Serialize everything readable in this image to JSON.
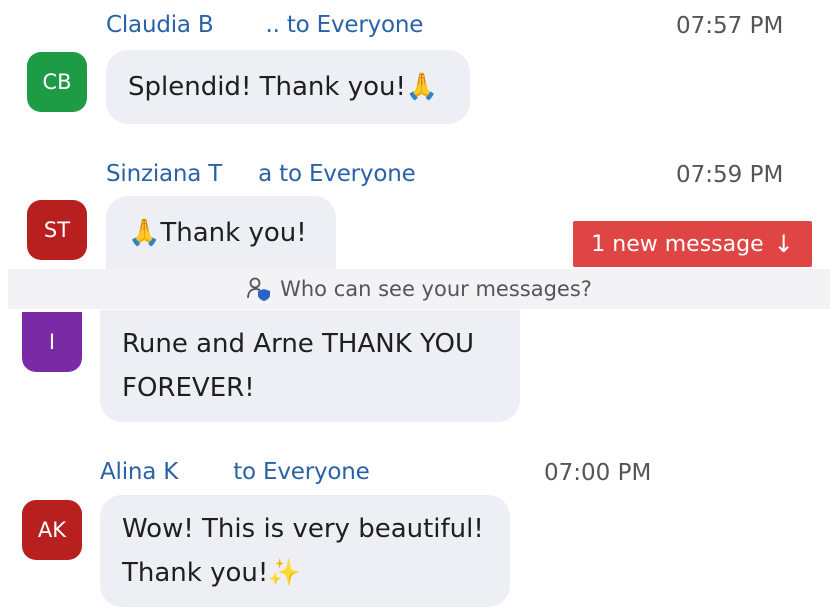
{
  "messages": [
    {
      "sender_first": "Claudia B",
      "sender_rest": "..  to ",
      "recipient": "Everyone",
      "time": "07:57 PM",
      "initials": "CB",
      "avatar_color": "#1e9b45",
      "text": "Splendid! Thank you!",
      "emoji": "🙏"
    },
    {
      "sender_first": "Sinziana T",
      "sender_rest": "a to ",
      "recipient": "Everyone",
      "time": "07:59 PM",
      "initials": "ST",
      "avatar_color": "#b82020",
      "text_before_emoji": "🙏",
      "text": "Thank you!"
    },
    {
      "initials": "I",
      "avatar_color": "#7a2aa5",
      "line1": "Rune and Arne THANK YOU",
      "line2": "FOREVER!"
    },
    {
      "sender_first": "Alina K",
      "sender_rest": "to ",
      "recipient": "Everyone",
      "time": "07:00 PM",
      "initials": "AK",
      "avatar_color": "#b82020",
      "line1": "Wow! This is very beautiful!",
      "line2": "Thank you!",
      "emoji": "✨"
    }
  ],
  "new_message_button": {
    "label": "1 new message",
    "arrow": "↓",
    "color": "#e04545"
  },
  "privacy_bar": {
    "label": "Who can see your messages?",
    "icon": "person-shield-icon"
  }
}
